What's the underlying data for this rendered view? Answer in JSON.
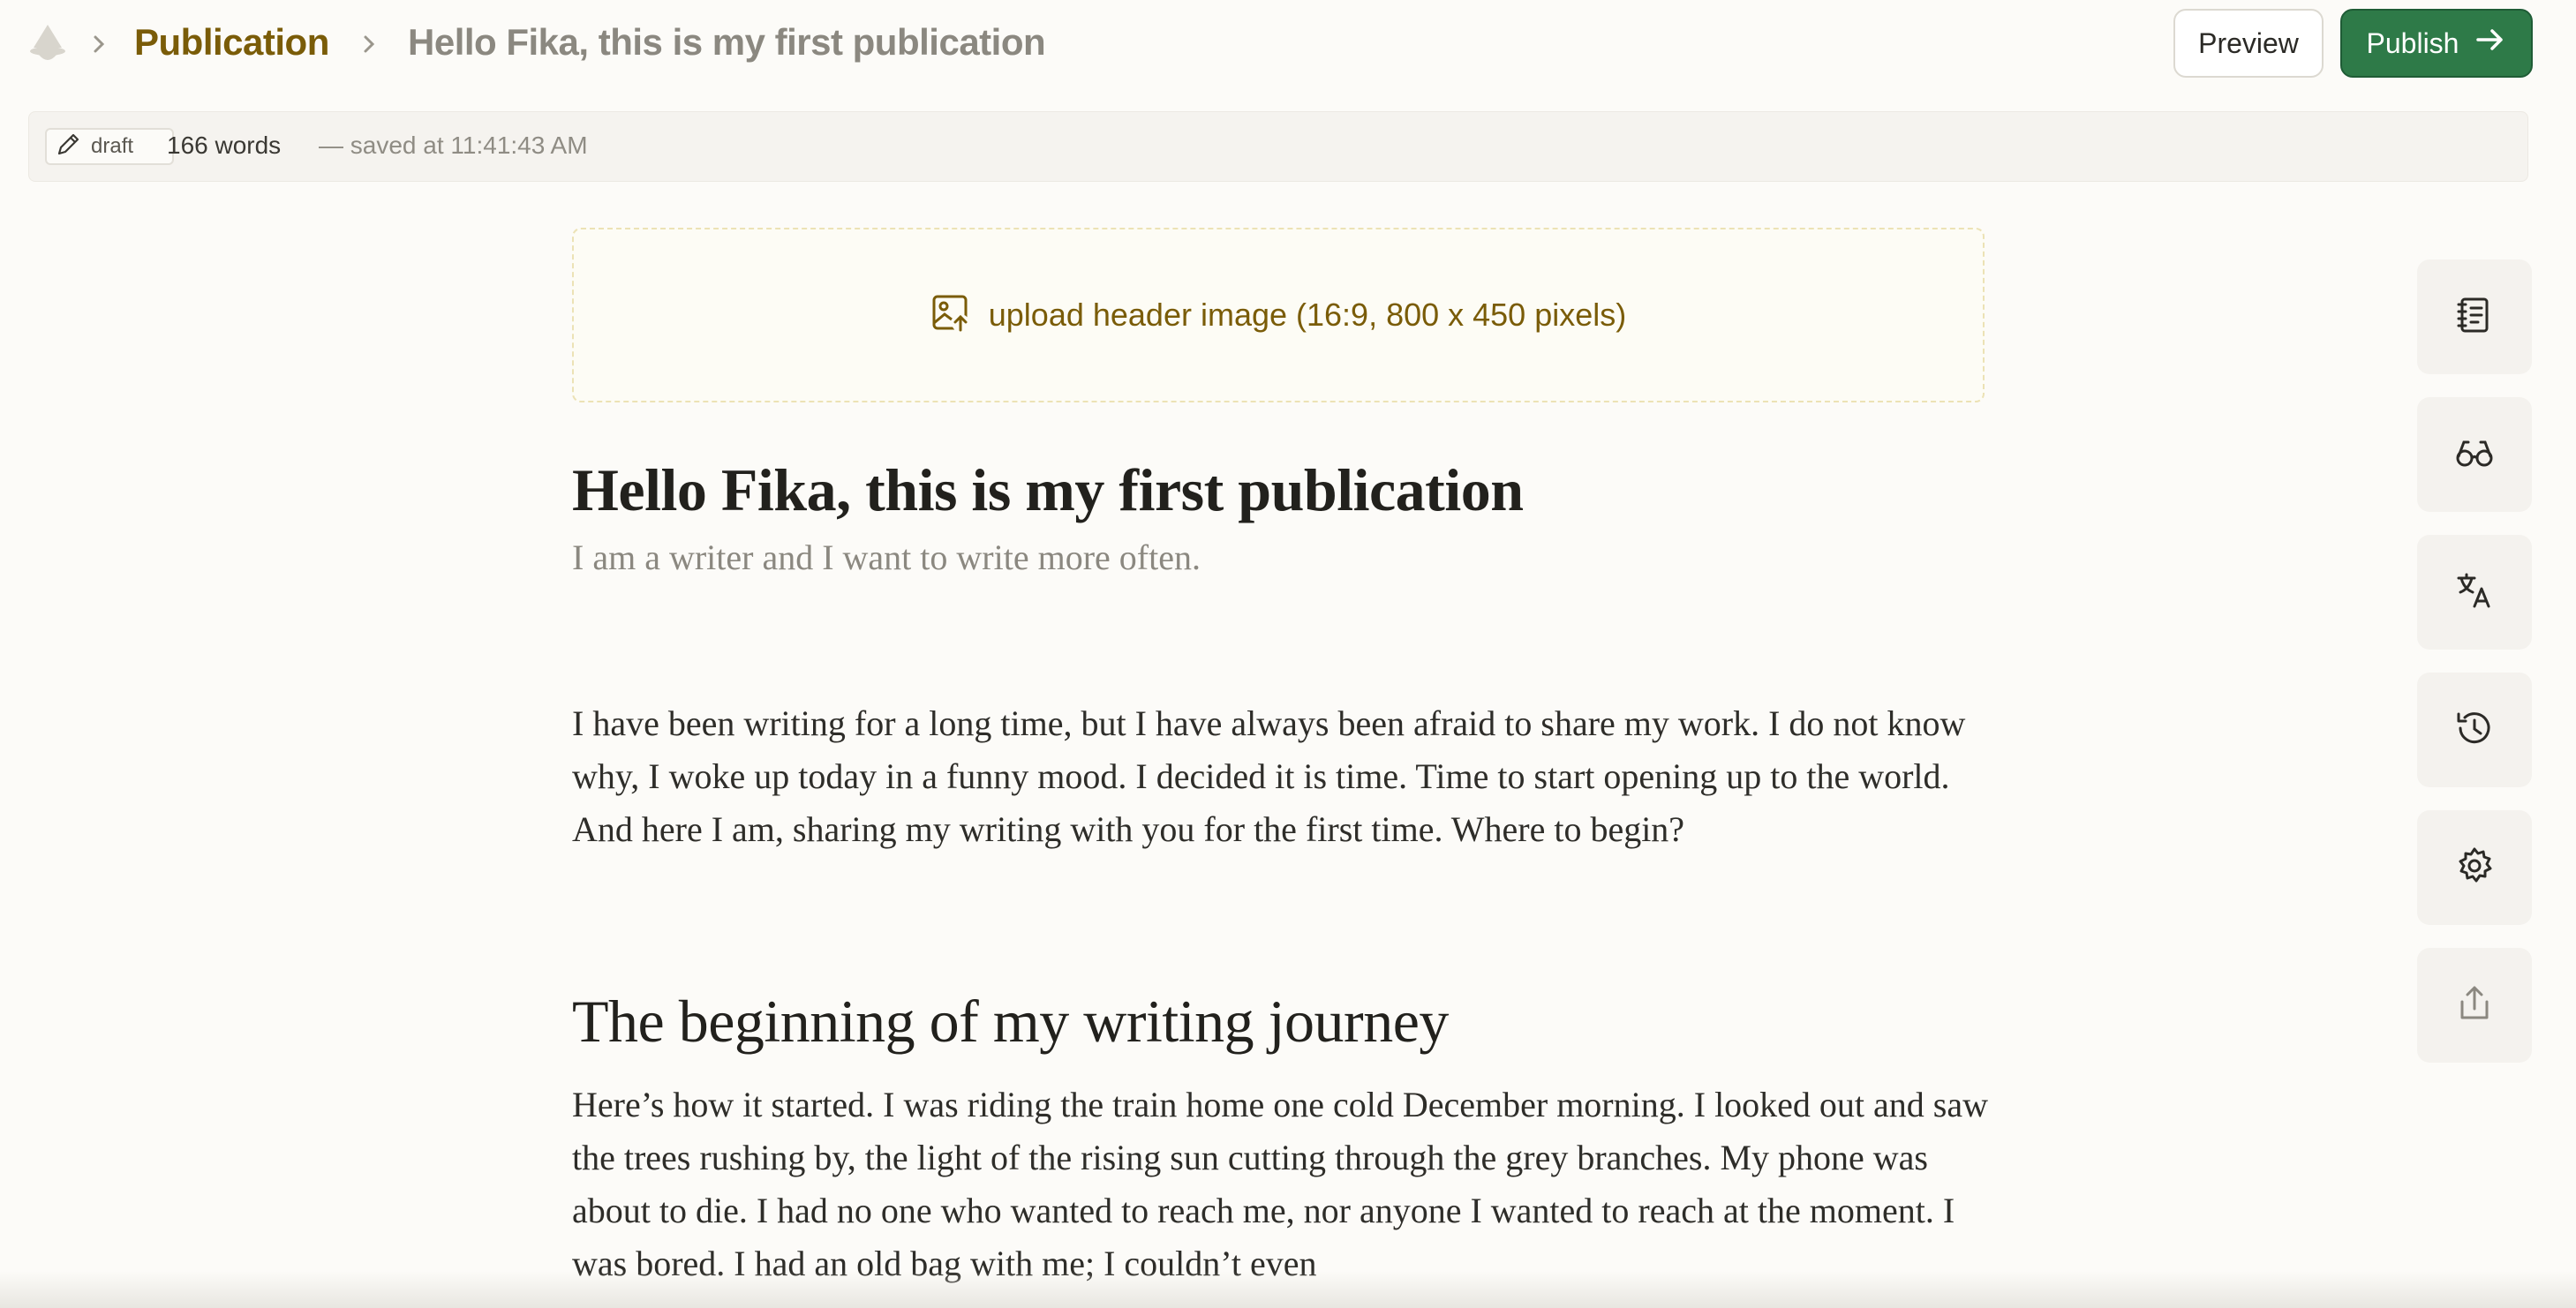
{
  "breadcrumb": {
    "publication": "Publication",
    "document": "Hello Fika, this is my first publication"
  },
  "toolbar": {
    "preview_label": "Preview",
    "publish_label": "Publish"
  },
  "status": {
    "badge": "draft",
    "word_count": "166 words",
    "saved": "— saved at 11:41:43 AM"
  },
  "editor": {
    "upload_label": "upload header image (16:9, 800 x 450 pixels)",
    "title": "Hello Fika, this is my first publication",
    "subtitle": "I am a writer and I want to write more often.",
    "paragraph1": "I have been writing for a long time, but I have always been afraid to share my work. I do not know why, I woke up today in a funny mood. I decided it is time. Time to start opening up to the world. And here I am, sharing my writing with you for the first time. Where to begin?",
    "heading2": "The beginning of my writing journey",
    "paragraph2": "Here’s how it started. I was riding the train home one cold December morning. I looked out and saw the trees rushing by, the light of the rising sun cutting through the grey branches. My phone was about to die. I had no one who wanted to reach me, nor anyone I wanted to reach at the moment. I was bored. I had an old bag with me; I couldn’t even"
  },
  "rail": {
    "icons": [
      "notebook-icon",
      "glasses-icon",
      "translate-icon",
      "history-icon",
      "gear-icon",
      "share-icon"
    ]
  },
  "colors": {
    "accent": "#7a5c08",
    "publish": "#2e7a48",
    "background": "#fcfbf8"
  }
}
